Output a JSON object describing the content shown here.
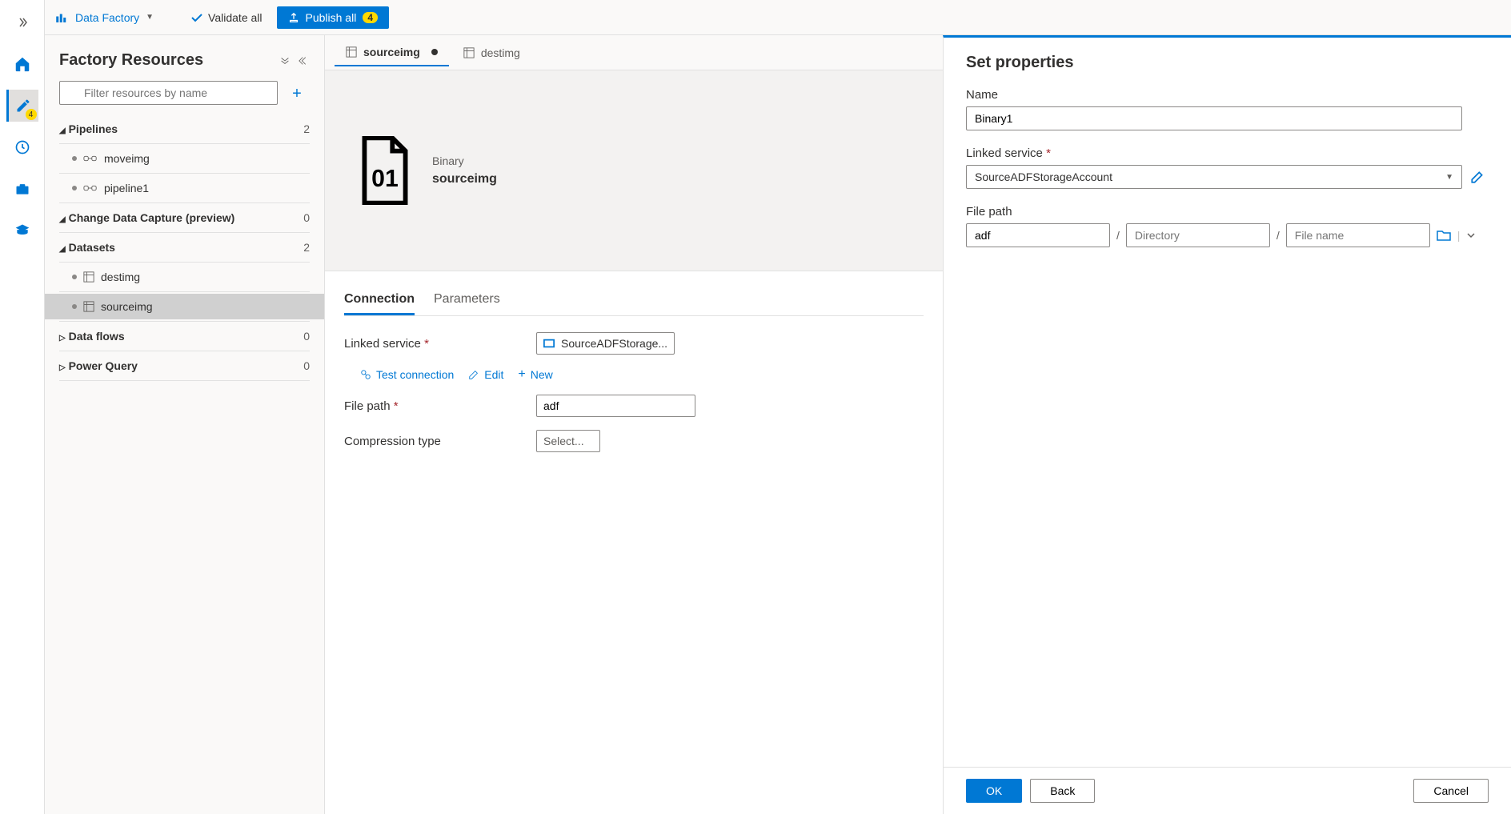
{
  "topbar": {
    "df_label": "Data Factory",
    "validate": "Validate all",
    "publish": "Publish all",
    "publish_count": "4"
  },
  "leftrail": {
    "pencil_badge": "4"
  },
  "tree": {
    "title": "Factory Resources",
    "filter_placeholder": "Filter resources by name",
    "sections": {
      "pipelines": {
        "label": "Pipelines",
        "count": "2"
      },
      "cdc": {
        "label": "Change Data Capture (preview)",
        "count": "0"
      },
      "datasets": {
        "label": "Datasets",
        "count": "2"
      },
      "dataflows": {
        "label": "Data flows",
        "count": "0"
      },
      "powerquery": {
        "label": "Power Query",
        "count": "0"
      }
    },
    "pipelines": [
      {
        "name": "moveimg"
      },
      {
        "name": "pipeline1"
      }
    ],
    "datasets": [
      {
        "name": "destimg"
      },
      {
        "name": "sourceimg"
      }
    ]
  },
  "tabs": [
    {
      "name": "sourceimg",
      "modified": true,
      "active": true
    },
    {
      "name": "destimg",
      "modified": false,
      "active": false
    }
  ],
  "dataset": {
    "type": "Binary",
    "name": "sourceimg"
  },
  "props": {
    "tabs": {
      "connection": "Connection",
      "parameters": "Parameters"
    },
    "linked_service_label": "Linked service",
    "linked_service_value": "SourceADFStorage...",
    "test": "Test connection",
    "edit": "Edit",
    "new": "New",
    "file_path_label": "File path",
    "file_path_value": "adf",
    "compression_label": "Compression type",
    "compression_value": "Select..."
  },
  "panel": {
    "title": "Set properties",
    "name_label": "Name",
    "name_value": "Binary1",
    "linked_label": "Linked service",
    "linked_value": "SourceADFStorageAccount",
    "filepath_label": "File path",
    "container_value": "adf",
    "directory_placeholder": "Directory",
    "filename_placeholder": "File name",
    "ok": "OK",
    "back": "Back",
    "cancel": "Cancel"
  }
}
